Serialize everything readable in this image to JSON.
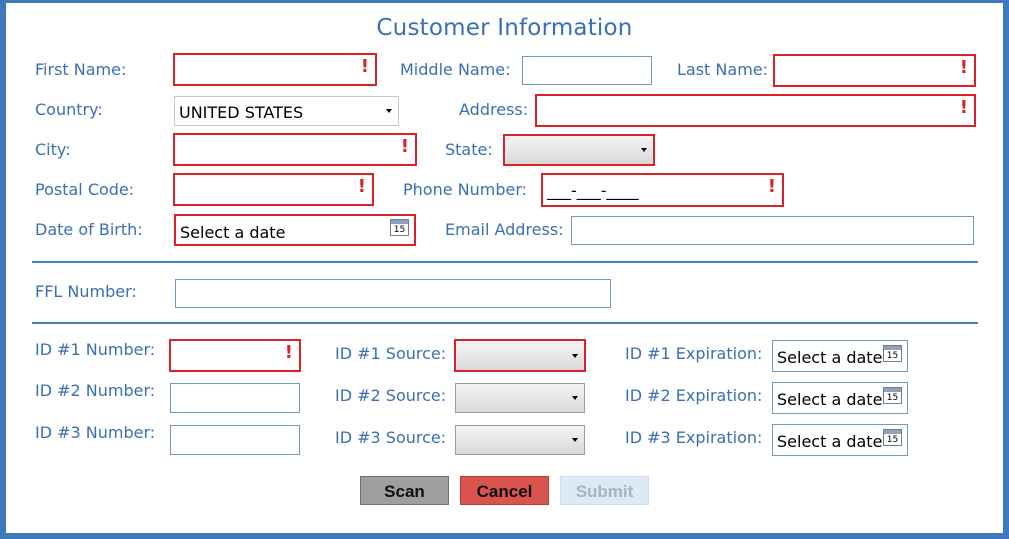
{
  "form": {
    "title": "Customer Information",
    "labels": {
      "first_name": "First Name:",
      "middle_name": "Middle Name:",
      "last_name": "Last Name:",
      "country": "Country:",
      "address": "Address:",
      "city": "City:",
      "state": "State:",
      "postal_code": "Postal Code:",
      "phone_number": "Phone Number:",
      "date_of_birth": "Date of Birth:",
      "email_address": "Email Address:",
      "ffl_number": "FFL Number:",
      "id1_number": "ID #1 Number:",
      "id1_source": "ID #1 Source:",
      "id1_expiration": "ID #1 Expiration:",
      "id2_number": "ID #2 Number:",
      "id2_source": "ID #2 Source:",
      "id2_expiration": "ID #2 Expiration:",
      "id3_number": "ID #3 Number:",
      "id3_source": "ID #3 Source:",
      "id3_expiration": "ID #3 Expiration:"
    },
    "values": {
      "country": "UNITED STATES",
      "phone_number": "___-___-____",
      "date_placeholder": "Select a date",
      "calendar_day": "15"
    },
    "error_mark": "!"
  },
  "buttons": {
    "scan": "Scan",
    "cancel": "Cancel",
    "submit": "Submit"
  },
  "colors": {
    "accent": "#3a6fb5",
    "error": "#d9232a",
    "cancel": "#d9534f",
    "scan": "#9e9e9e",
    "submit_disabled": "#dde9f5"
  }
}
